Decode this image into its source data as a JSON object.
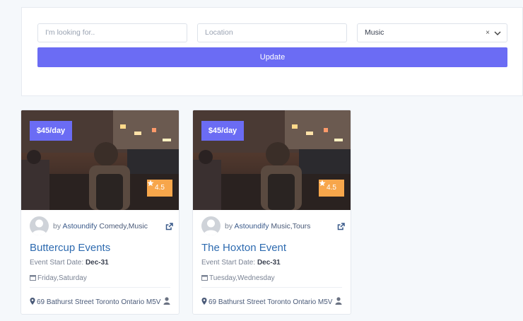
{
  "search": {
    "keyword_placeholder": "I'm looking for..",
    "location_placeholder": "Location",
    "category_value": "Music",
    "clear_glyph": "×",
    "update_label": "Update"
  },
  "cards": [
    {
      "price": "$45/day",
      "rating": "4.5",
      "by": "by",
      "author": "Astoundify",
      "categories": "Comedy,Music",
      "title": "Buttercup Events",
      "start_label": "Event Start Date:",
      "start_date": "Dec-31",
      "days": "Friday,Saturday",
      "address": "69 Bathurst Street Toronto Ontario M5V"
    },
    {
      "price": "$45/day",
      "rating": "4.5",
      "by": "by",
      "author": "Astoundify",
      "categories": "Music,Tours",
      "title": "The Hoxton Event",
      "start_label": "Event Start Date:",
      "start_date": "Dec-31",
      "days": "Tuesday,Wednesday",
      "address": "69 Bathurst Street Toronto Ontario M5V"
    }
  ],
  "colors": {
    "accent": "#6b6cf4",
    "rating": "#f7a64b",
    "title": "#2e6bb0"
  },
  "icons": [
    "chevron-down-icon",
    "star-icon",
    "avatar",
    "external-link-icon",
    "calendar-icon",
    "map-pin-icon",
    "user-icon"
  ]
}
